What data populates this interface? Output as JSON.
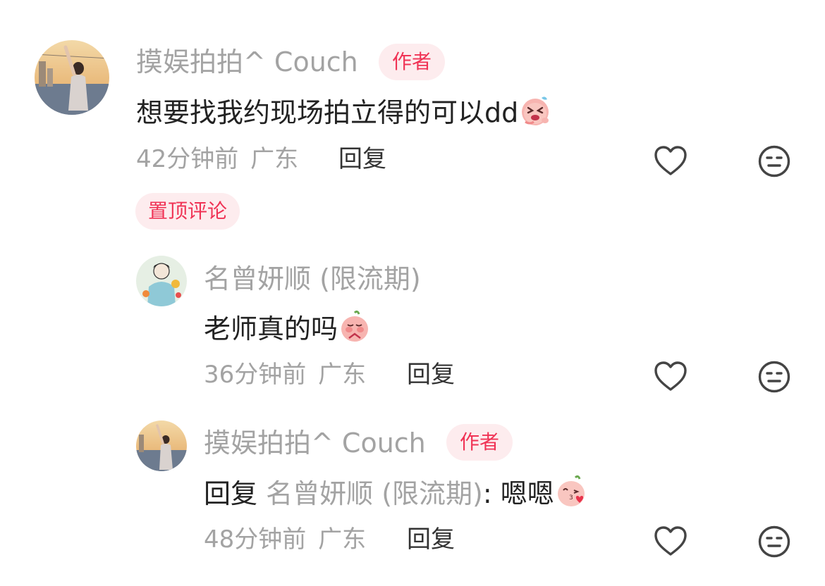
{
  "comments": [
    {
      "author": "摸娱拍拍^ Couch",
      "badge": "作者",
      "text": "想要找我约现场拍立得的可以dd",
      "emoji": "laughing-tears-emoji",
      "time": "42分钟前",
      "region": "广东",
      "reply_label": "回复",
      "pinned_label": "置顶评论"
    }
  ],
  "replies": [
    {
      "author": "名曾妍顺 (限流期)",
      "text": "老师真的吗",
      "emoji": "pleading-emoji",
      "time": "36分钟前",
      "region": "广东",
      "reply_label": "回复"
    },
    {
      "author": "摸娱拍拍^ Couch",
      "badge": "作者",
      "reply_prefix": "回复",
      "reply_target": "名曾妍顺 (限流期)",
      "separator": ":",
      "text": "嗯嗯",
      "emoji": "kiss-heart-emoji",
      "time": "48分钟前",
      "region": "广东",
      "reply_label": "回复"
    }
  ],
  "icons": {
    "like": "heart-outline-icon",
    "dislike": "meh-face-icon"
  },
  "colors": {
    "accent": "#f03355",
    "badge_bg": "#fdecee",
    "muted": "#a3a3a3",
    "text": "#222222"
  }
}
